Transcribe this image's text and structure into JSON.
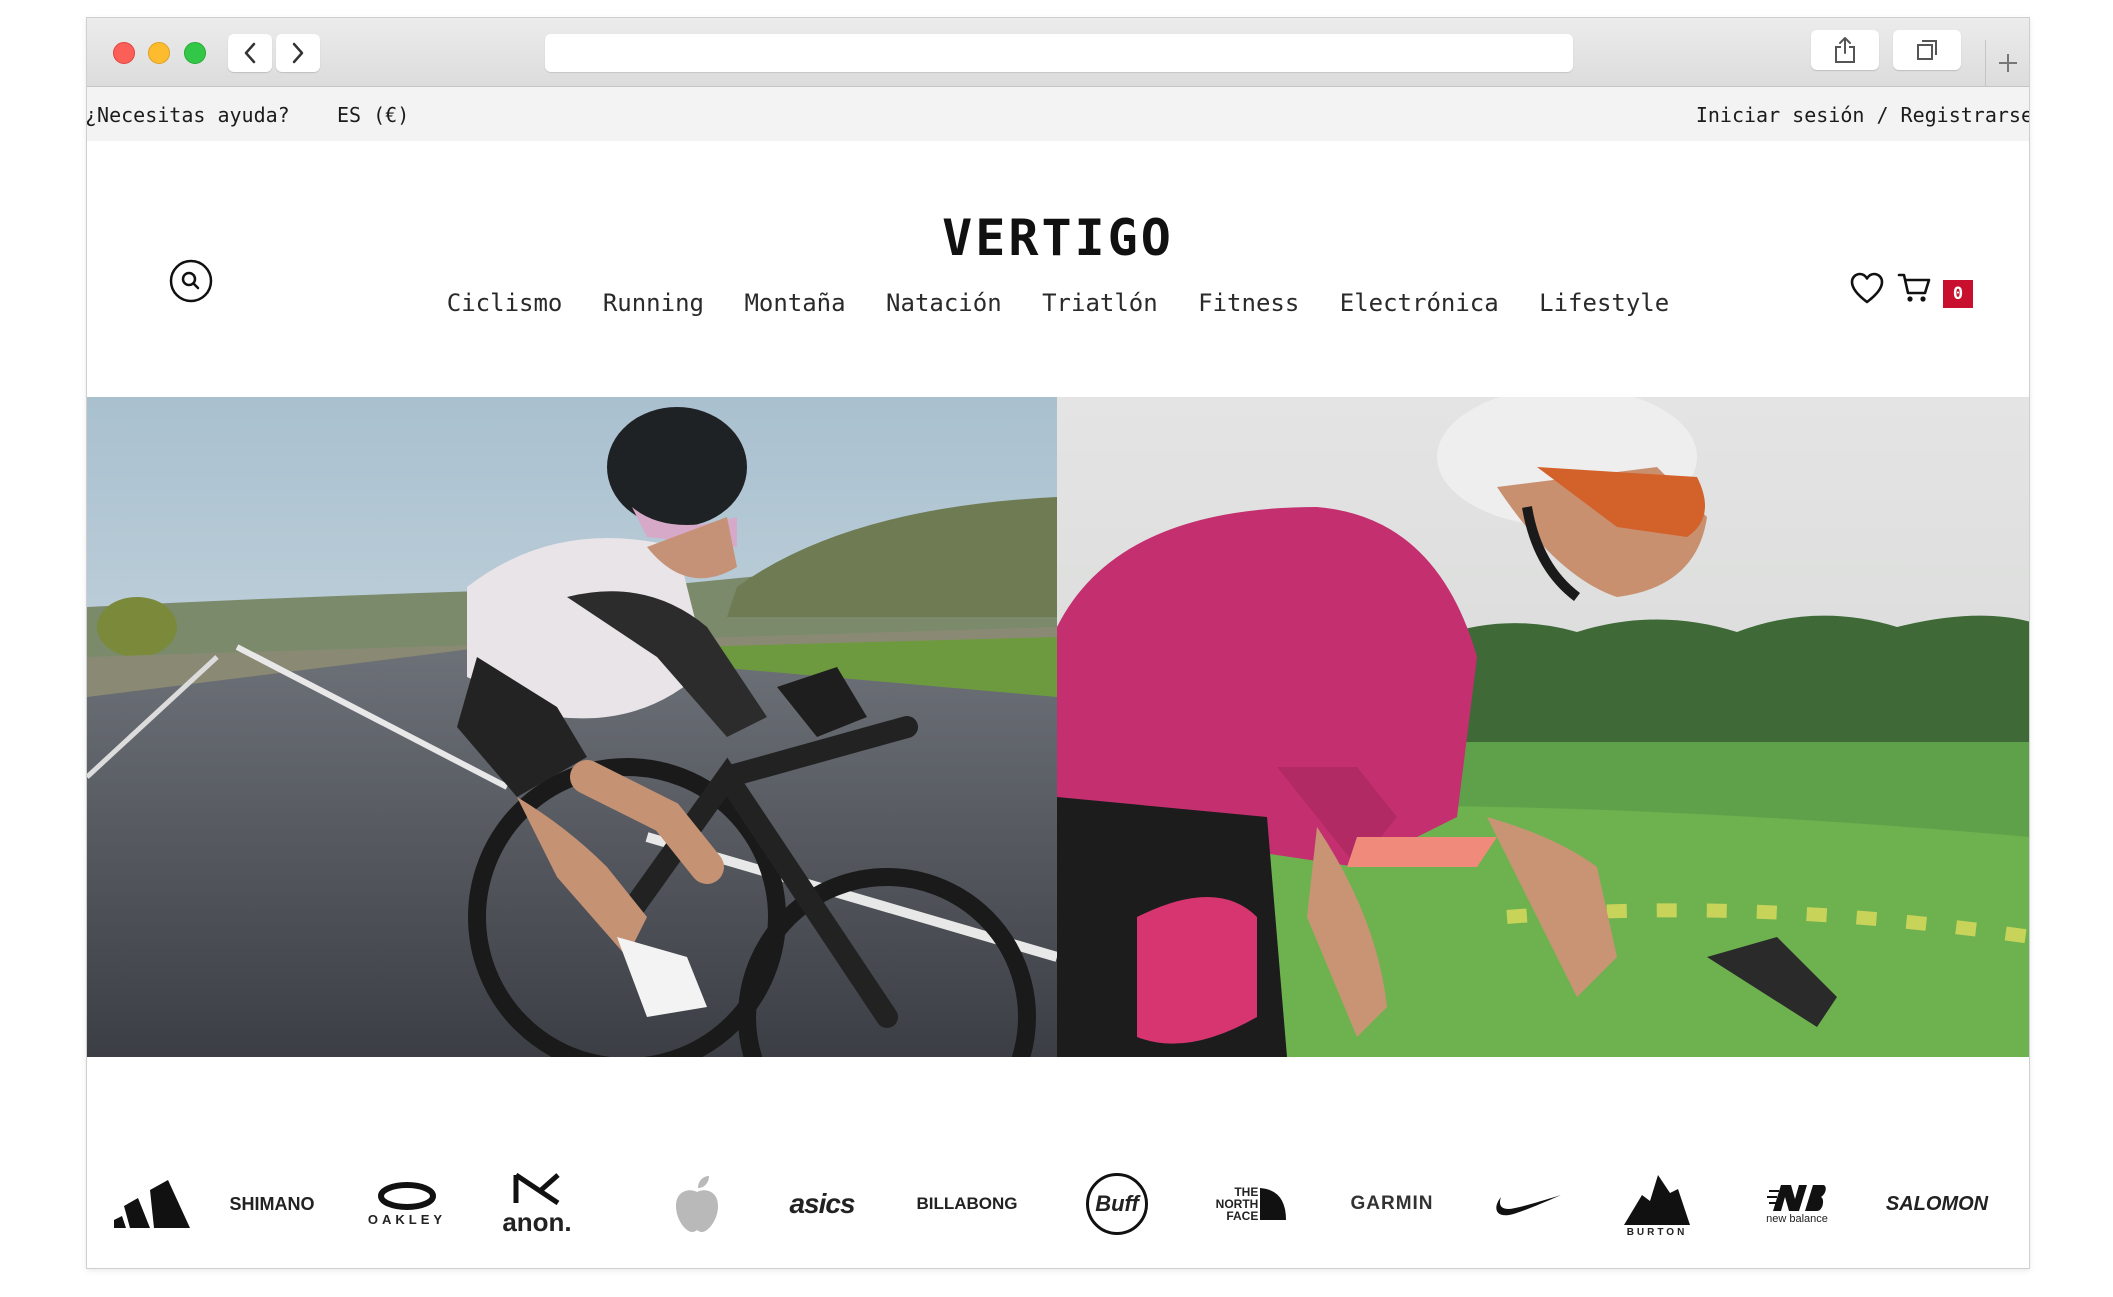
{
  "topbar": {
    "help": "¿Necesitas ayuda?",
    "lang": "ES (€)",
    "login": "Iniciar sesión / Registrarse"
  },
  "header": {
    "logo": "VERTIGO",
    "nav": [
      "Ciclismo",
      "Running",
      "Montaña",
      "Natación",
      "Triatlón",
      "Fitness",
      "Electrónica",
      "Lifestyle"
    ],
    "cart_count": "0"
  },
  "brands": {
    "shimano": "SHIMANO",
    "oakley": "OAKLEY",
    "anon": "anon.",
    "asics": "asics",
    "billabong": "BILLABONG",
    "buff": "Buff",
    "tnf1": "THE",
    "tnf2": "NORTH",
    "tnf3": "FACE",
    "garmin": "GARMIN",
    "burton": "BURTON",
    "nb": "new balance",
    "salomon": "SALOMON"
  },
  "icons": {
    "search": "search-icon",
    "wishlist": "heart-icon",
    "cart": "cart-icon",
    "share": "share-icon",
    "tabs": "tabs-icon",
    "back": "chevron-left-icon",
    "forward": "chevron-right-icon",
    "new_tab": "plus-icon"
  },
  "colors": {
    "badge": "#c8102e",
    "topbar_bg": "#f3f3f3"
  }
}
